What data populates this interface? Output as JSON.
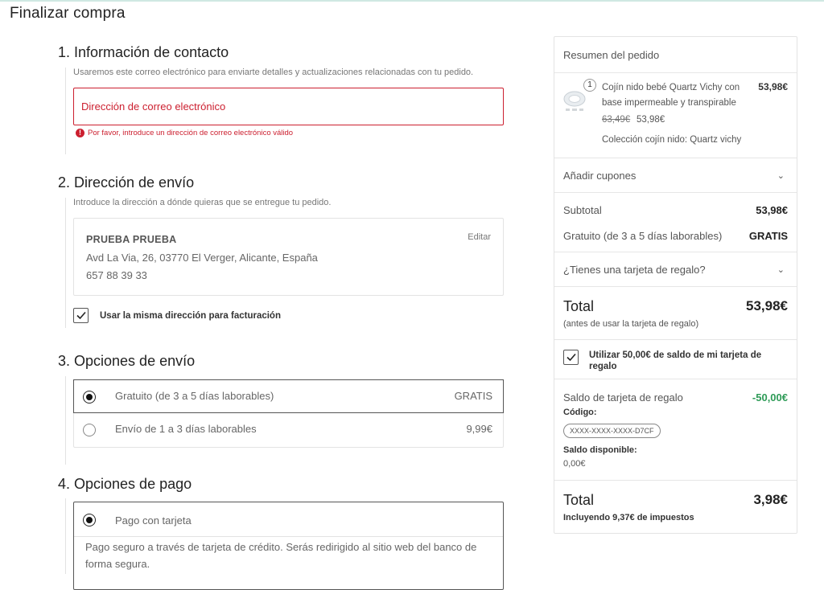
{
  "page": {
    "title": "Finalizar compra"
  },
  "contact": {
    "title": "1. Información de contacto",
    "desc": "Usaremos este correo electrónico para enviarte detalles y actualizaciones relacionadas con tu pedido.",
    "email_placeholder": "Dirección de correo electrónico",
    "error": "Por favor, introduce un dirección de correo electrónico válido"
  },
  "shipping_address": {
    "title": "2. Dirección de envío",
    "desc": "Introduce la dirección a dónde quieras que se entregue tu pedido.",
    "name": "PRUEBA PRUEBA",
    "address": "Avd La Via, 26, 03770 El Verger, Alicante, España",
    "phone": "657 88 39 33",
    "edit_label": "Editar",
    "same_billing_label": "Usar la misma dirección para facturación",
    "same_billing_checked": true
  },
  "shipping_options": {
    "title": "3. Opciones de envío",
    "options": [
      {
        "label": "Gratuito (de 3 a 5 días laborables)",
        "price": "GRATIS",
        "selected": true
      },
      {
        "label": "Envío de 1 a 3 días laborables",
        "price": "9,99€",
        "selected": false
      }
    ]
  },
  "payment": {
    "title": "4. Opciones de pago",
    "option_label": "Pago con tarjeta",
    "option_desc": "Pago seguro a través de tarjeta de crédito. Serás redirigido al sitio web del banco de forma segura."
  },
  "summary": {
    "title": "Resumen del pedido",
    "item": {
      "qty": "1",
      "name": "Cojín nido bebé Quartz Vichy con base impermeable y transpirable",
      "price": "53,98€",
      "old_price": "63,49€",
      "new_price": "53,98€",
      "variant": "Colección cojín nido: Quartz vichy"
    },
    "coupons_label": "Añadir cupones",
    "subtotal_label": "Subtotal",
    "subtotal_value": "53,98€",
    "shipping_label": "Gratuito (de 3 a 5 días laborables)",
    "shipping_value": "GRATIS",
    "gift_card_question": "¿Tienes una tarjeta de regalo?",
    "total_label": "Total",
    "total_value": "53,98€",
    "total_note": "(antes de usar la tarjeta de regalo)",
    "use_balance_label": "Utilizar 50,00€ de saldo de mi tarjeta de regalo",
    "use_balance_checked": true,
    "gift_balance_label": "Saldo de tarjeta de regalo",
    "gift_balance_value": "-50,00€",
    "code_label": "Código:",
    "code_value": "XXXX-XXXX-XXXX-D7CF",
    "available_label": "Saldo disponible:",
    "available_value": "0,00€",
    "final_total_label": "Total",
    "final_total_value": "3,98€",
    "taxes_note": "Incluyendo 9,37€ de impuestos"
  },
  "colors": {
    "error": "#cc1f2f",
    "success": "#2e9b57",
    "border": "#e3e3e3"
  }
}
